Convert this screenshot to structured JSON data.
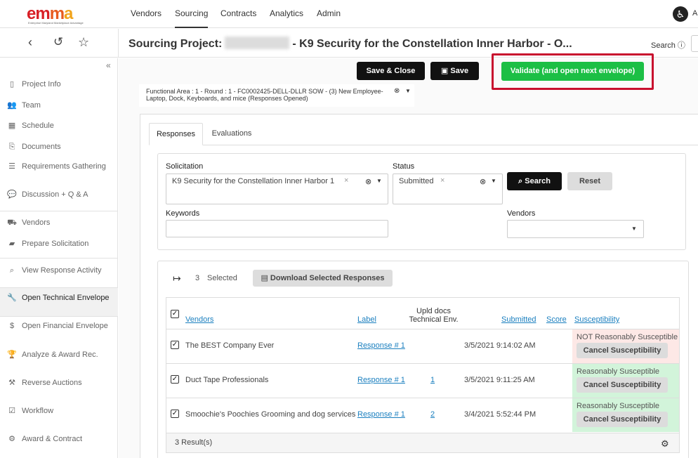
{
  "brand": {
    "logo_e": "e",
    "logo_m1": "m",
    "logo_m2": "m",
    "logo_a": "a",
    "tagline": "Enterprise Maryland Marketplace Advantage"
  },
  "nav": {
    "items": [
      "Vendors",
      "Sourcing",
      "Contracts",
      "Analytics",
      "Admin"
    ],
    "user_initial": "A"
  },
  "subbar": {
    "title_prefix": "Sourcing Project:",
    "title_suffix": "- K9 Security for the Constellation Inner Harbor - O...",
    "search_label": "Search"
  },
  "sidebar": {
    "items": [
      {
        "label": "Project Info",
        "icon": "clipboard-icon",
        "glyph": "▯"
      },
      {
        "label": "Team",
        "icon": "team-icon",
        "glyph": "👥"
      },
      {
        "label": "Schedule",
        "icon": "calendar-icon",
        "glyph": "▦"
      },
      {
        "label": "Documents",
        "icon": "documents-icon",
        "glyph": "⎘"
      },
      {
        "label": "Requirements Gathering",
        "icon": "list-icon",
        "glyph": "☰"
      },
      {
        "label": "Discussion + Q & A",
        "icon": "chat-icon",
        "glyph": "💬"
      },
      {
        "label": "Vendors",
        "icon": "truck-icon",
        "glyph": "⛟"
      },
      {
        "label": "Prepare Solicitation",
        "icon": "folder-icon",
        "glyph": "▰"
      },
      {
        "label": "View Response Activity",
        "icon": "binoculars-icon",
        "glyph": "⌕"
      },
      {
        "label": "Open Technical Envelope",
        "icon": "wrench-icon",
        "glyph": "🔧"
      },
      {
        "label": "Open Financial Envelope",
        "icon": "dollar-icon",
        "glyph": "$"
      },
      {
        "label": "Analyze & Award Rec.",
        "icon": "trophy-icon",
        "glyph": "🏆"
      },
      {
        "label": "Reverse Auctions",
        "icon": "gavel-icon",
        "glyph": "⚒"
      },
      {
        "label": "Workflow",
        "icon": "check-square-icon",
        "glyph": "☑"
      },
      {
        "label": "Award & Contract",
        "icon": "award-icon",
        "glyph": "⚙"
      }
    ]
  },
  "toolbar": {
    "save_close": "Save & Close",
    "save": "Save",
    "validate": "Validate (and open next envelope)"
  },
  "envelope": {
    "text": "Functional Area : 1 - Round : 1 - FC0002425-DELL-DLLR SOW - (3) New Employee- Laptop, Dock, Keyboards, and mice (Responses Opened)"
  },
  "tabs": {
    "responses": "Responses",
    "evaluations": "Evaluations"
  },
  "filters": {
    "solicitation_label": "Solicitation",
    "solicitation_value": "K9 Security for the Constellation Inner Harbor 1",
    "status_label": "Status",
    "status_value": "Submitted",
    "search_btn": "Search",
    "reset_btn": "Reset",
    "keywords_label": "Keywords",
    "vendors_label": "Vendors"
  },
  "results": {
    "selected_count": "3",
    "selected_label": "Selected",
    "download_btn": "Download Selected Responses",
    "headers": {
      "vendors": "Vendors",
      "label": "Label",
      "upld_line1": "Upld docs",
      "upld_line2": "Technical Env.",
      "submitted": "Submitted",
      "score": "Score",
      "susceptibility": "Susceptibility"
    },
    "rows": [
      {
        "vendor": "The BEST Company Ever",
        "label": "Response # 1",
        "docs": "",
        "submitted": "3/5/2021 9:14:02 AM",
        "susceptibility": "NOT Reasonably Susceptible",
        "sus_state": "not",
        "cancel": "Cancel Susceptibility"
      },
      {
        "vendor": "Duct Tape Professionals",
        "label": "Response # 1",
        "docs": "1",
        "submitted": "3/5/2021 9:11:25 AM",
        "susceptibility": "Reasonably Susceptible",
        "sus_state": "yes",
        "cancel": "Cancel Susceptibility"
      },
      {
        "vendor": "Smoochie's Poochies Grooming and dog services",
        "label": "Response # 1",
        "docs": "2",
        "submitted": "3/4/2021 5:52:44 PM",
        "susceptibility": "Reasonably Susceptible",
        "sus_state": "yes",
        "cancel": "Cancel Susceptibility"
      }
    ],
    "count_text": "3 Result(s)"
  },
  "colors": {
    "accent_green": "#1cbf45",
    "highlight_red": "#c8102e",
    "link_blue": "#1a7fbf"
  }
}
